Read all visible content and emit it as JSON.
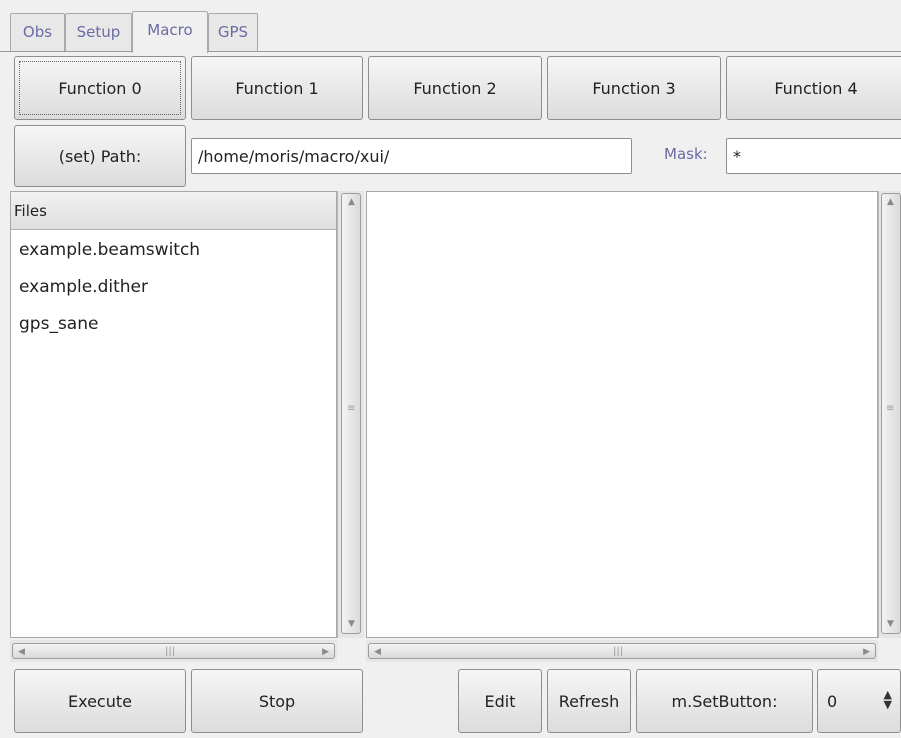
{
  "tabs": [
    {
      "label": "Obs",
      "active": false
    },
    {
      "label": "Setup",
      "active": false
    },
    {
      "label": "Macro",
      "active": true
    },
    {
      "label": "GPS",
      "active": false
    }
  ],
  "functions": [
    "Function 0",
    "Function 1",
    "Function 2",
    "Function 3",
    "Function 4"
  ],
  "path": {
    "button_label": "(set) Path:",
    "value": "/home/moris/macro/xui/",
    "mask_label": "Mask:",
    "mask_value": "*"
  },
  "files": {
    "header": "Files",
    "items": [
      "example.beamswitch",
      "example.dither",
      "gps_sane"
    ]
  },
  "bottom": {
    "execute": "Execute",
    "stop": "Stop",
    "edit": "Edit",
    "refresh": "Refresh",
    "setbutton": "m.SetButton:",
    "spin_value": "0"
  },
  "colors": {
    "tab_text": "#6b6ba3",
    "background": "#f0f0f0"
  }
}
